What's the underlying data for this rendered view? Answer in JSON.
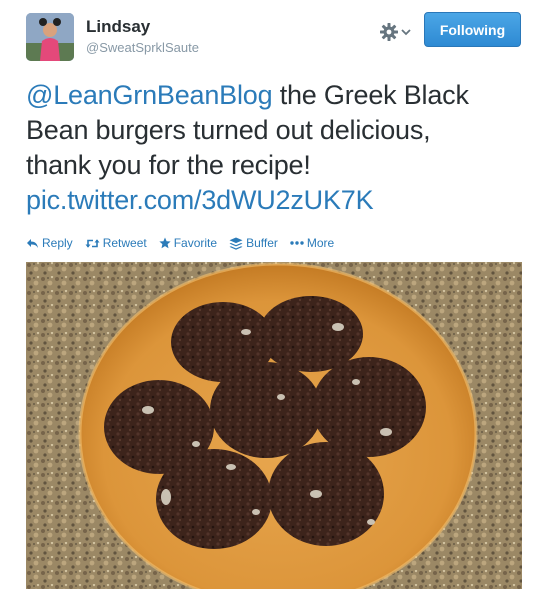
{
  "user": {
    "name": "Lindsay",
    "handle": "@SweatSprklSaute"
  },
  "follow_button": {
    "label": "Following"
  },
  "settings": {
    "icon": "gear-icon",
    "menu_icon": "chevron-down-icon"
  },
  "tweet": {
    "mention": "@LeanGrnBeanBlog",
    "line1_rest": " the Greek Black",
    "line2": "Bean burgers turned out delicious,",
    "line3": "thank you for the recipe!",
    "link": "pic.twitter.com/3dWU2zUK7K"
  },
  "actions": [
    {
      "label": "Reply",
      "icon": "reply-icon"
    },
    {
      "label": "Retweet",
      "icon": "retweet-icon"
    },
    {
      "label": "Favorite",
      "icon": "star-icon"
    },
    {
      "label": "Buffer",
      "icon": "buffer-icon"
    },
    {
      "label": "More",
      "icon": "more-dots-icon"
    }
  ],
  "colors": {
    "link": "#2b7bb9",
    "follow_button": "#2e8ad3",
    "text": "#292f33",
    "muted": "#8899a6"
  }
}
